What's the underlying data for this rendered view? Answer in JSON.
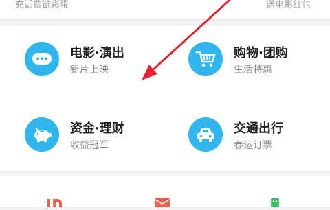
{
  "top_banner": {
    "left_text": "充话费链彩蛋",
    "right_text": "送电影红包"
  },
  "services": [
    {
      "title": "电影·演出",
      "subtitle": "新片上映",
      "icon": "chat-bubble-icon",
      "color": "#2fb6ef"
    },
    {
      "title": "购物·团购",
      "subtitle": "生活特惠",
      "icon": "shopping-cart-icon",
      "color": "#2fb6ef"
    },
    {
      "title": "资金·理财",
      "subtitle": "收益冠军",
      "icon": "piggy-bank-icon",
      "color": "#2fb6ef"
    },
    {
      "title": "交通出行",
      "subtitle": "春运订票",
      "icon": "car-icon",
      "color": "#2fb6ef"
    }
  ],
  "bottom_icons": [
    {
      "icon": "id-icon",
      "color": "#f2604a"
    },
    {
      "icon": "envelope-icon",
      "color": "#f2604a"
    },
    {
      "icon": "phone-icon",
      "color": "#3fbf6a"
    }
  ],
  "annotation": {
    "icon": "pointer-arrow-icon",
    "color": "#e8232f"
  }
}
